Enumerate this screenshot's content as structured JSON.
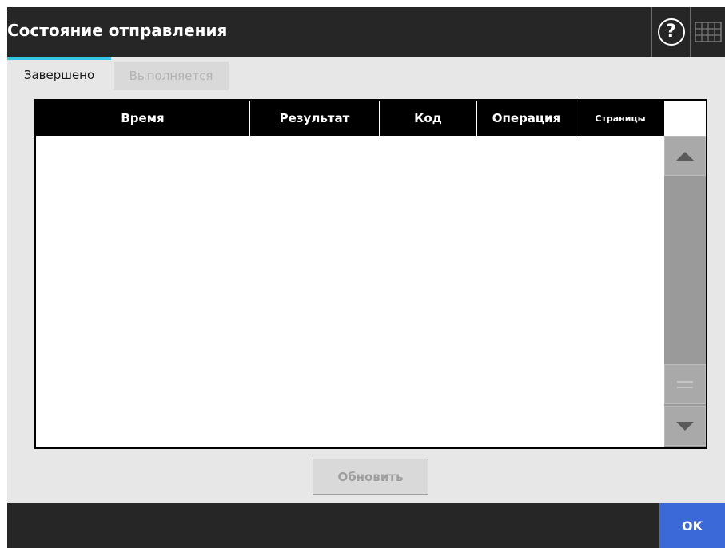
{
  "window": {
    "title": "Состояние отправления"
  },
  "header_icons": {
    "help": "help-icon",
    "keyboard": "keyboard-icon",
    "help_glyph": "?"
  },
  "tabs": [
    {
      "label": "Завершено",
      "active": true
    },
    {
      "label": "Выполняется",
      "active": false
    }
  ],
  "table": {
    "columns": [
      "Время",
      "Результат",
      "Код",
      "Операция",
      "Страницы"
    ],
    "rows": []
  },
  "scrollbar": {
    "up_icon": "arrow-up-icon",
    "grip_icon": "scroll-grip-icon",
    "down_icon": "arrow-down-icon"
  },
  "actions": {
    "refresh_label": "Обновить",
    "ok_label": "OK"
  },
  "colors": {
    "titlebar": "#262626",
    "tab_accent": "#33c4e6",
    "ok_button": "#3b6ad8"
  }
}
